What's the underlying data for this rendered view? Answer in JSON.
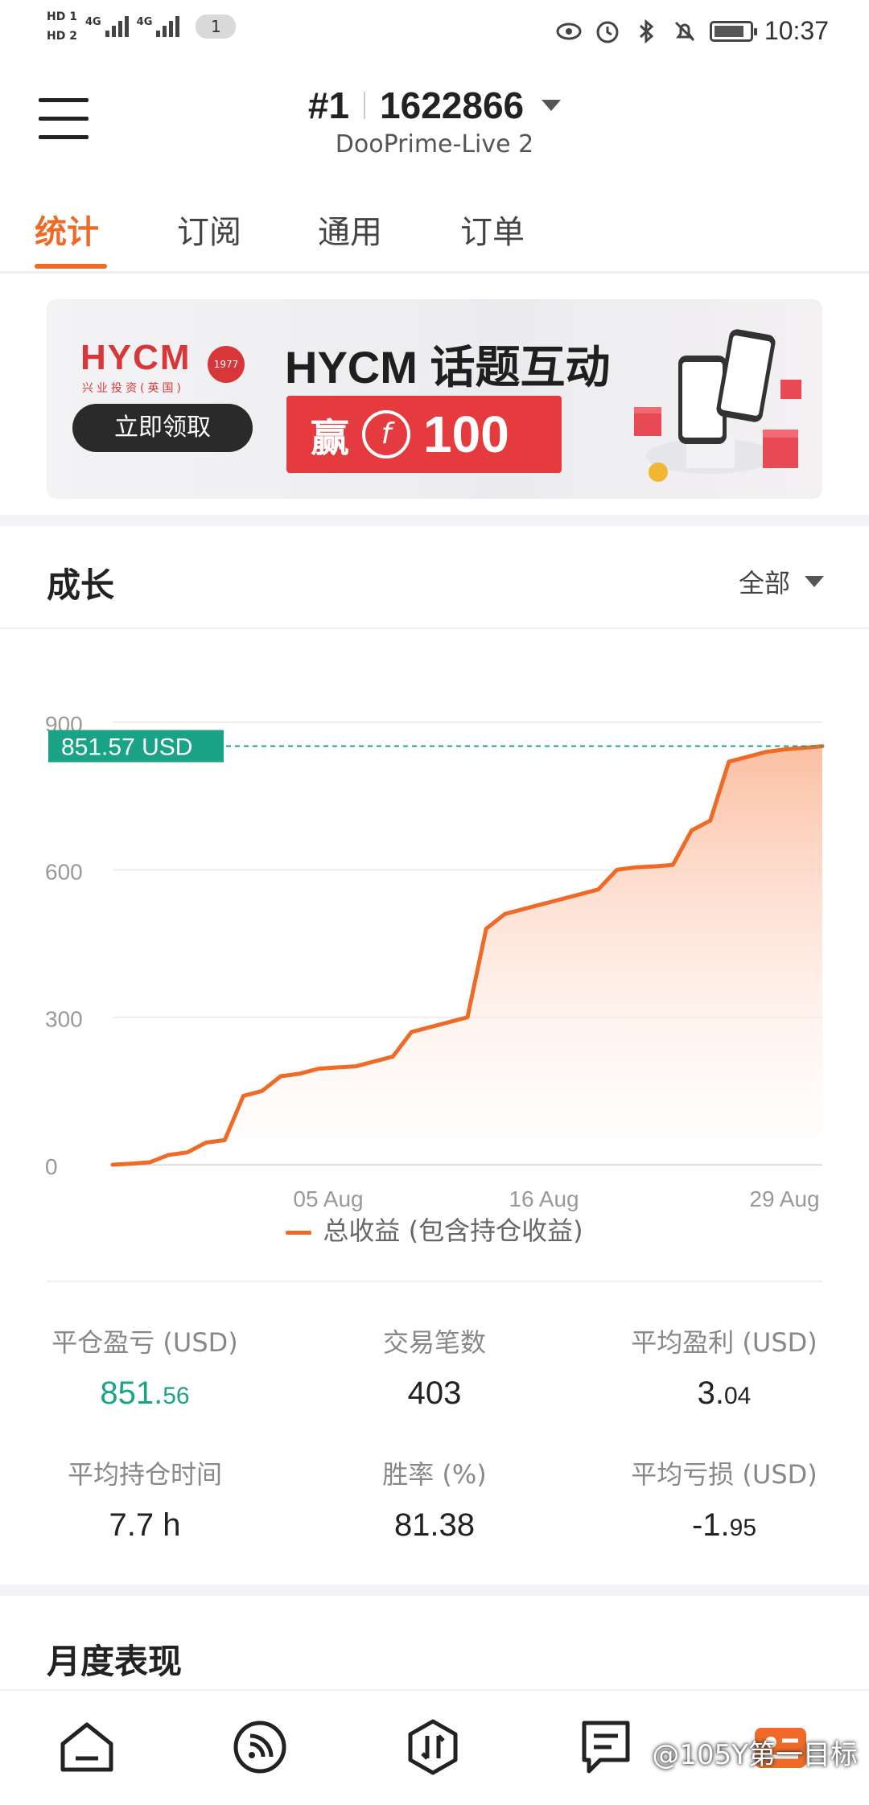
{
  "status_bar": {
    "hd1": "HD 1",
    "hd2": "HD 2",
    "net1": "4G",
    "net2": "4G",
    "sim_badge": "1",
    "time": "10:37"
  },
  "header": {
    "account_no": "#1",
    "account_id": "1622866",
    "server": "DooPrime-Live 2"
  },
  "tabs": [
    "统计",
    "订阅",
    "通用",
    "订单"
  ],
  "banner": {
    "logo": "HYCM",
    "logo_sub": "兴业投资(英国)",
    "seal": "1977",
    "claim_button": "立即领取",
    "title": "HYCM 话题互动",
    "win": "赢",
    "coin": "f",
    "amount": "100"
  },
  "growth": {
    "title": "成长",
    "filter": "全部"
  },
  "chart_data": {
    "type": "area",
    "y_ticks": [
      "900",
      "600",
      "300",
      "0"
    ],
    "ylim": [
      0,
      900
    ],
    "x_tick_labels": [
      "05 Aug",
      "16 Aug",
      "29 Aug"
    ],
    "current_value_label": "851.57 USD",
    "current_value": 851.57,
    "series": [
      {
        "name": "总收益 (包含持仓收益)",
        "values": [
          0,
          2,
          5,
          20,
          25,
          45,
          50,
          140,
          150,
          180,
          185,
          195,
          198,
          200,
          210,
          220,
          270,
          280,
          290,
          300,
          480,
          510,
          520,
          530,
          540,
          550,
          560,
          600,
          605,
          607,
          610,
          680,
          700,
          820,
          830,
          840,
          845,
          848,
          851.57
        ]
      }
    ],
    "colors": {
      "line": "#ee6a26",
      "fill_top": "#fbbfa2",
      "marker": "#1aa386"
    }
  },
  "legend_label": "总收益 (包含持仓收益)",
  "stats": [
    {
      "label": "平仓盈亏 (USD)",
      "int": "851.",
      "dec": "56",
      "highlight": true
    },
    {
      "label": "交易笔数",
      "int": "403",
      "dec": "",
      "highlight": false
    },
    {
      "label": "平均盈利 (USD)",
      "int": "3.",
      "dec": "04",
      "highlight": false
    },
    {
      "label": "平均持仓时间",
      "int": "7.7 h",
      "dec": "",
      "highlight": false
    },
    {
      "label": "胜率 (%)",
      "int": "81.38",
      "dec": "",
      "highlight": false
    },
    {
      "label": "平均亏损 (USD)",
      "int": "-1.",
      "dec": "95",
      "highlight": false
    }
  ],
  "monthly_title": "月度表现",
  "watermark": "@105Y第一目标",
  "nav_icons": [
    "home-icon",
    "signal-feed-icon",
    "trade-icon",
    "news-icon",
    "profile-icon"
  ]
}
